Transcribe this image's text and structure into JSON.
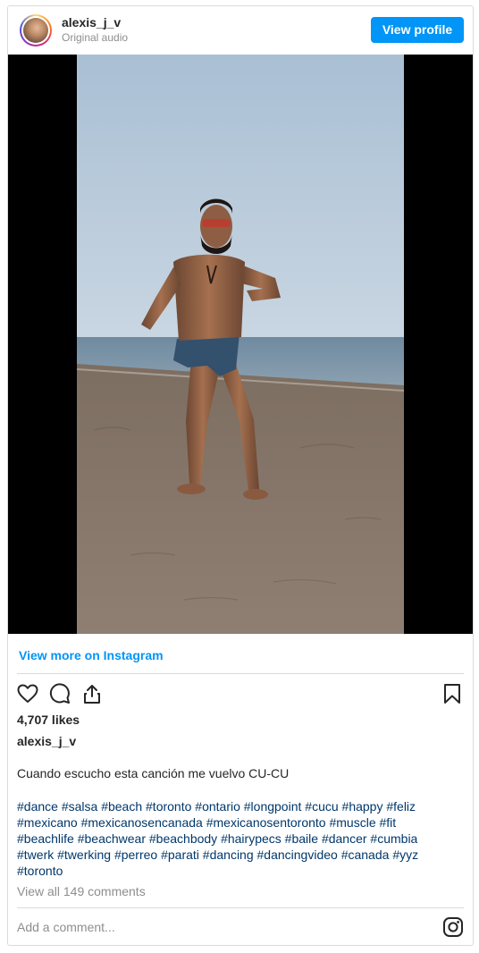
{
  "header": {
    "username": "alexis_j_v",
    "subtitle": "Original audio",
    "view_profile_label": "View profile"
  },
  "media": {
    "description_icon": "video-frame"
  },
  "view_more_label": "View more on Instagram",
  "actions": {
    "like_icon": "heart-icon",
    "comment_icon": "comment-icon",
    "share_icon": "share-icon",
    "save_icon": "bookmark-icon"
  },
  "likes_text": "4,707 likes",
  "caption": {
    "username": "alexis_j_v",
    "text": "Cuando escucho esta canción me vuelvo CU-CU",
    "hashtags": [
      "#dance",
      "#salsa",
      "#beach",
      "#toronto",
      "#ontario",
      "#longpoint",
      "#cucu",
      "#happy",
      "#feliz",
      "#mexicano",
      "#mexicanosencanada",
      "#mexicanosentoronto",
      "#muscle",
      "#fit",
      "#beachlife",
      "#beachwear",
      "#beachbody",
      "#hairypecs",
      "#baile",
      "#dancer",
      "#cumbia",
      "#twerk",
      "#twerking",
      "#perreo",
      "#parati",
      "#dancing",
      "#dancingvideo",
      "#canada",
      "#yyz",
      "#toronto"
    ]
  },
  "view_comments_label": "View all 149 comments",
  "comment_placeholder": "Add a comment...",
  "colors": {
    "accent": "#0095f6",
    "hashtag": "#00376b",
    "muted": "#8e8e8e"
  }
}
